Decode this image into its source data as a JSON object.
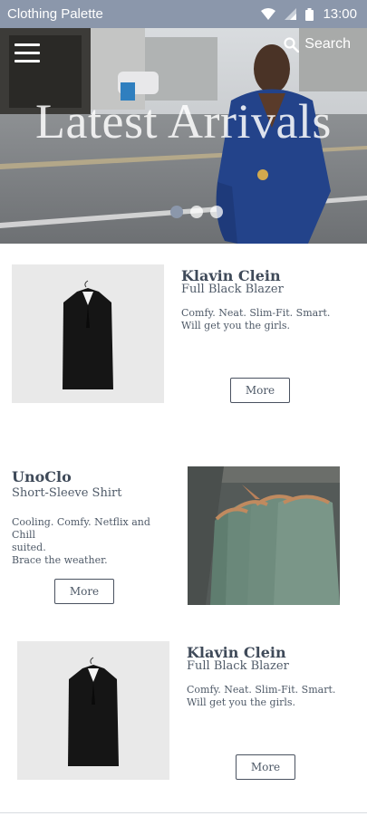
{
  "status_bar": {
    "app_name": "Clothing Palette",
    "time": "13:00",
    "icons": [
      "wifi-icon",
      "signal-icon",
      "battery-icon"
    ]
  },
  "hero": {
    "title": "Latest Arrivals",
    "search_label": "Search",
    "carousel_active_index": 0,
    "carousel_count": 3
  },
  "products": [
    {
      "brand": "Klavin Clein",
      "name": "Full Black Blazer",
      "description_line1": "Comfy. Neat. Slim-Fit. Smart.",
      "description_line2": "Will get you the girls.",
      "button": "More"
    },
    {
      "brand": "UnoClo",
      "name": "Short-Sleeve Shirt",
      "description_line1": "Cooling. Comfy. Netflix and Chill",
      "description_line2": "suited.",
      "description_line3": "Brace the weather.",
      "button": "More"
    },
    {
      "brand": "Klavin Clein",
      "name": "Full Black Blazer",
      "description_line1": "Comfy. Neat. Slim-Fit. Smart.",
      "description_line2": "Will get you the girls.",
      "button": "More"
    }
  ],
  "colors": {
    "status_bar": "#8b97ab",
    "text_primary": "#3f4a59",
    "blazer_background": "#e9e9e9",
    "shirt_color": "#6f8c7e"
  }
}
